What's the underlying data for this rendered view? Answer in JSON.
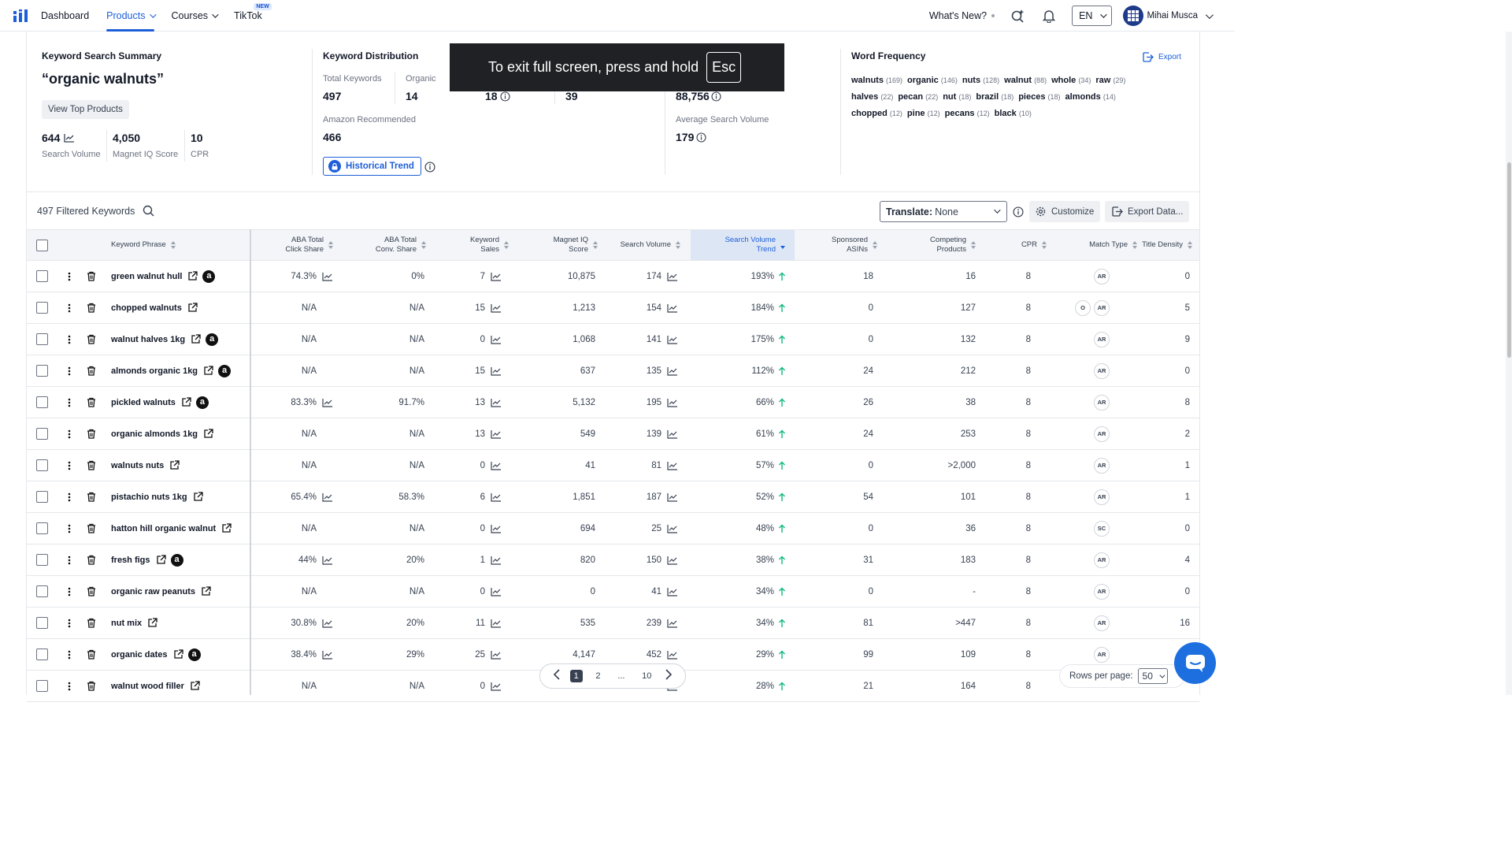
{
  "nav": {
    "items": [
      {
        "label": "Dashboard",
        "active": false,
        "dropdown": false
      },
      {
        "label": "Products",
        "active": true,
        "dropdown": true
      },
      {
        "label": "Courses",
        "active": false,
        "dropdown": true
      },
      {
        "label": "TikTok",
        "active": false,
        "dropdown": false,
        "badge": "NEW"
      }
    ],
    "whats_new": "What's New?",
    "language": "EN",
    "user_name": "Mihai Musca"
  },
  "summary": {
    "title": "Keyword Search Summary",
    "keyword": "“organic walnuts”",
    "view_top_products": "View Top Products",
    "metrics": [
      {
        "value": "644",
        "label": "Search Volume"
      },
      {
        "value": "4,050",
        "label": "Magnet IQ Score"
      },
      {
        "value": "10",
        "label": "CPR"
      }
    ]
  },
  "distribution": {
    "title": "Keyword Distribution",
    "total_keywords_label": "Total Keywords",
    "total_keywords": "497",
    "organic_label": "Organic",
    "organic": "14",
    "val_3": "18",
    "val_4": "39",
    "amazon_recommended_label": "Amazon Recommended",
    "amazon_recommended": "466",
    "historical_trend": "Historical Trend",
    "total_search_volume": "88,756",
    "avg_search_volume_label": "Average Search Volume",
    "avg_search_volume": "179"
  },
  "word_frequency": {
    "title": "Word Frequency",
    "export": "Export",
    "words": [
      {
        "w": "walnuts",
        "c": "(169)"
      },
      {
        "w": "organic",
        "c": "(146)"
      },
      {
        "w": "nuts",
        "c": "(128)"
      },
      {
        "w": "walnut",
        "c": "(88)"
      },
      {
        "w": "whole",
        "c": "(34)"
      },
      {
        "w": "raw",
        "c": "(29)"
      },
      {
        "w": "halves",
        "c": "(22)"
      },
      {
        "w": "pecan",
        "c": "(22)"
      },
      {
        "w": "nut",
        "c": "(18)"
      },
      {
        "w": "brazil",
        "c": "(18)"
      },
      {
        "w": "pieces",
        "c": "(18)"
      },
      {
        "w": "almonds",
        "c": "(14)"
      },
      {
        "w": "chopped",
        "c": "(12)"
      },
      {
        "w": "pine",
        "c": "(12)"
      },
      {
        "w": "pecans",
        "c": "(12)"
      },
      {
        "w": "black",
        "c": "(10)"
      }
    ]
  },
  "fullscreen_notice": {
    "text": "To exit full screen, press and hold",
    "key": "Esc"
  },
  "toolbar": {
    "filtered": "497 Filtered Keywords",
    "translate_label": "Translate:",
    "translate_value": "None",
    "customize": "Customize",
    "export_data": "Export Data..."
  },
  "columns": [
    {
      "key": "phrase",
      "l1": "Keyword Phrase",
      "l2": ""
    },
    {
      "key": "aba_click",
      "l1": "ABA Total",
      "l2": "Click Share"
    },
    {
      "key": "aba_conv",
      "l1": "ABA Total",
      "l2": "Conv. Share"
    },
    {
      "key": "kw_sales",
      "l1": "Keyword",
      "l2": "Sales"
    },
    {
      "key": "miq",
      "l1": "Magnet IQ",
      "l2": "Score"
    },
    {
      "key": "sv",
      "l1": "Search Volume",
      "l2": ""
    },
    {
      "key": "svt",
      "l1": "Search Volume",
      "l2": "Trend"
    },
    {
      "key": "sp_asins",
      "l1": "Sponsored",
      "l2": "ASINs"
    },
    {
      "key": "comp",
      "l1": "Competing",
      "l2": "Products"
    },
    {
      "key": "cpr",
      "l1": "CPR",
      "l2": ""
    },
    {
      "key": "match",
      "l1": "Match Type",
      "l2": ""
    },
    {
      "key": "td",
      "l1": "Title Density",
      "l2": ""
    }
  ],
  "rows": [
    {
      "phrase": "green walnut hull",
      "amz": true,
      "click": "74.3%",
      "click_chart": true,
      "conv": "0%",
      "sales": "7",
      "miq": "10,875",
      "sv": "174",
      "svt": "193%",
      "sp": "18",
      "comp": "16",
      "cpr": "8",
      "match": [
        "AR"
      ],
      "td": "0"
    },
    {
      "phrase": "chopped walnuts",
      "amz": false,
      "click": "N/A",
      "click_chart": false,
      "conv": "N/A",
      "sales": "15",
      "miq": "1,213",
      "sv": "154",
      "svt": "184%",
      "sp": "0",
      "comp": "127",
      "cpr": "8",
      "match": [
        "O",
        "AR"
      ],
      "td": "5"
    },
    {
      "phrase": "walnut halves 1kg",
      "amz": true,
      "click": "N/A",
      "click_chart": false,
      "conv": "N/A",
      "sales": "0",
      "miq": "1,068",
      "sv": "141",
      "svt": "175%",
      "sp": "0",
      "comp": "132",
      "cpr": "8",
      "match": [
        "AR"
      ],
      "td": "9"
    },
    {
      "phrase": "almonds organic 1kg",
      "amz": true,
      "click": "N/A",
      "click_chart": false,
      "conv": "N/A",
      "sales": "15",
      "miq": "637",
      "sv": "135",
      "svt": "112%",
      "sp": "24",
      "comp": "212",
      "cpr": "8",
      "match": [
        "AR"
      ],
      "td": "0"
    },
    {
      "phrase": "pickled walnuts",
      "amz": true,
      "click": "83.3%",
      "click_chart": true,
      "conv": "91.7%",
      "sales": "13",
      "miq": "5,132",
      "sv": "195",
      "svt": "66%",
      "sp": "26",
      "comp": "38",
      "cpr": "8",
      "match": [
        "AR"
      ],
      "td": "8"
    },
    {
      "phrase": "organic almonds 1kg",
      "amz": false,
      "click": "N/A",
      "click_chart": false,
      "conv": "N/A",
      "sales": "13",
      "miq": "549",
      "sv": "139",
      "svt": "61%",
      "sp": "24",
      "comp": "253",
      "cpr": "8",
      "match": [
        "AR"
      ],
      "td": "2"
    },
    {
      "phrase": "walnuts nuts",
      "amz": false,
      "click": "N/A",
      "click_chart": false,
      "conv": "N/A",
      "sales": "0",
      "miq": "41",
      "sv": "81",
      "svt": "57%",
      "sp": "0",
      "comp": ">2,000",
      "cpr": "8",
      "match": [
        "AR"
      ],
      "td": "1"
    },
    {
      "phrase": "pistachio nuts 1kg",
      "amz": false,
      "click": "65.4%",
      "click_chart": true,
      "conv": "58.3%",
      "sales": "6",
      "miq": "1,851",
      "sv": "187",
      "svt": "52%",
      "sp": "54",
      "comp": "101",
      "cpr": "8",
      "match": [
        "AR"
      ],
      "td": "1"
    },
    {
      "phrase": "hatton hill organic walnut",
      "amz": false,
      "click": "N/A",
      "click_chart": false,
      "conv": "N/A",
      "sales": "0",
      "miq": "694",
      "sv": "25",
      "svt": "48%",
      "sp": "0",
      "comp": "36",
      "cpr": "8",
      "match": [
        "SC"
      ],
      "td": "0"
    },
    {
      "phrase": "fresh figs",
      "amz": true,
      "click": "44%",
      "click_chart": true,
      "conv": "20%",
      "sales": "1",
      "miq": "820",
      "sv": "150",
      "svt": "38%",
      "sp": "31",
      "comp": "183",
      "cpr": "8",
      "match": [
        "AR"
      ],
      "td": "4"
    },
    {
      "phrase": "organic raw peanuts",
      "amz": false,
      "click": "N/A",
      "click_chart": false,
      "conv": "N/A",
      "sales": "0",
      "miq": "0",
      "sv": "41",
      "svt": "34%",
      "sp": "0",
      "comp": "-",
      "cpr": "8",
      "match": [
        "AR"
      ],
      "td": "0"
    },
    {
      "phrase": "nut mix",
      "amz": false,
      "click": "30.8%",
      "click_chart": true,
      "conv": "20%",
      "sales": "11",
      "miq": "535",
      "sv": "239",
      "svt": "34%",
      "sp": "81",
      "comp": ">447",
      "cpr": "8",
      "match": [
        "AR"
      ],
      "td": "16"
    },
    {
      "phrase": "organic dates",
      "amz": true,
      "click": "38.4%",
      "click_chart": true,
      "conv": "29%",
      "sales": "25",
      "miq": "4,147",
      "sv": "452",
      "svt": "29%",
      "sp": "99",
      "comp": "109",
      "cpr": "8",
      "match": [
        "AR"
      ],
      "td": ""
    },
    {
      "phrase": "walnut wood filler",
      "amz": false,
      "click": "N/A",
      "click_chart": false,
      "conv": "N/A",
      "sales": "0",
      "miq": "",
      "sv": "",
      "svt": "28%",
      "sp": "21",
      "comp": "164",
      "cpr": "8",
      "match": [],
      "td": ""
    }
  ],
  "pagination": {
    "pages": [
      "1",
      "2",
      "...",
      "10"
    ],
    "current": "1"
  },
  "rows_per_page": {
    "label": "Rows per page:",
    "value": "50"
  },
  "colors": {
    "accent": "#1d5fd8",
    "up_arrow": "#10b981",
    "sorted_header_bg": "#dde6f5"
  }
}
